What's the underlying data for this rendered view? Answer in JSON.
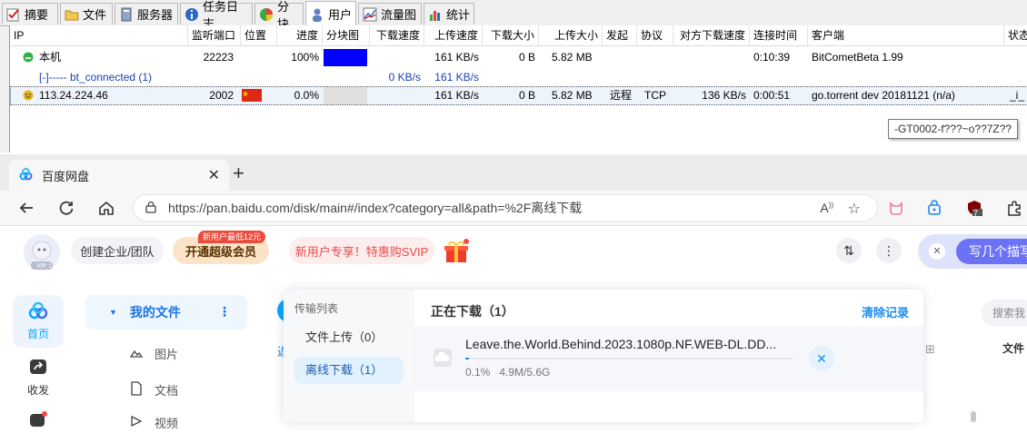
{
  "bitcomet": {
    "tabs": [
      "摘要",
      "文件",
      "服务器",
      "任务日志",
      "分块",
      "用户",
      "流量图",
      "统计"
    ],
    "active_tab": "用户",
    "columns": [
      "IP",
      "监听端口",
      "位置",
      "进度",
      "分块图",
      "下载速度",
      "上传速度",
      "下载大小",
      "上传大小",
      "发起",
      "协议",
      "对方下载速度",
      "连接时间",
      "客户端",
      "状态"
    ],
    "rows": [
      {
        "ip": "本机",
        "port": "22223",
        "location": "",
        "progress": "100%",
        "down_speed": "",
        "up_speed": "161 KB/s",
        "down_size": "0 B",
        "up_size": "5.82 MB",
        "initiator": "",
        "protocol": "",
        "peer_down_speed": "",
        "conn_time": "0:10:39",
        "client": "BitCometBeta 1.99",
        "status": ""
      },
      {
        "ip": "[-]----- bt_connected (1)",
        "port": "",
        "location": "",
        "progress": "",
        "down_speed": "0 KB/s",
        "up_speed": "161 KB/s",
        "down_size": "",
        "up_size": "",
        "initiator": "",
        "protocol": "",
        "peer_down_speed": "",
        "conn_time": "",
        "client": "",
        "status": ""
      },
      {
        "ip": "113.24.224.46",
        "port": "2002",
        "location": "",
        "progress": "0.0%",
        "down_speed": "",
        "up_speed": "161 KB/s",
        "down_size": "0 B",
        "up_size": "5.82 MB",
        "initiator": "远程",
        "protocol": "TCP",
        "peer_down_speed": "136 KB/s",
        "conn_time": "0:00:51",
        "client": "go.torrent dev 20181121 (n/a)",
        "status": "_i_"
      }
    ],
    "tooltip": "-GT0002-f???~o??7Z??"
  },
  "browser": {
    "tab_title": "百度网盘",
    "url": "https://pan.baidu.com/disk/main#/index?category=all&path=%2F离线下载",
    "extension_badge": "7"
  },
  "baidu": {
    "create_team": "创建企业/团队",
    "vip_button": "开通超级会员",
    "vip_tag": "新用户最低12元",
    "svip_promo": "新用户专享！特惠购SVIP",
    "write_button": "写几个描写",
    "left_nav": [
      "首页",
      "收发"
    ],
    "file_nav": {
      "active": "我的文件",
      "items": [
        "图片",
        "文档",
        "视频"
      ]
    },
    "right_search": "搜索我",
    "right_col_label": "文件",
    "behind_text": "返"
  },
  "transfer": {
    "panel_title": "传输列表",
    "upload_item": "文件上传（0）",
    "offline_item": "离线下载（1）",
    "downloading_title": "正在下载（1）",
    "clear_label": "清除记录",
    "task_name": "Leave.the.World.Behind.2023.1080p.NF.WEB-DL.DD...",
    "task_progress_text": "0.1%",
    "task_progress": 0.1,
    "task_size": "4.9M/5.6G"
  },
  "colors": {
    "piece_map_fill": "#0000ff",
    "baidu_blue": "#06a7ff"
  }
}
